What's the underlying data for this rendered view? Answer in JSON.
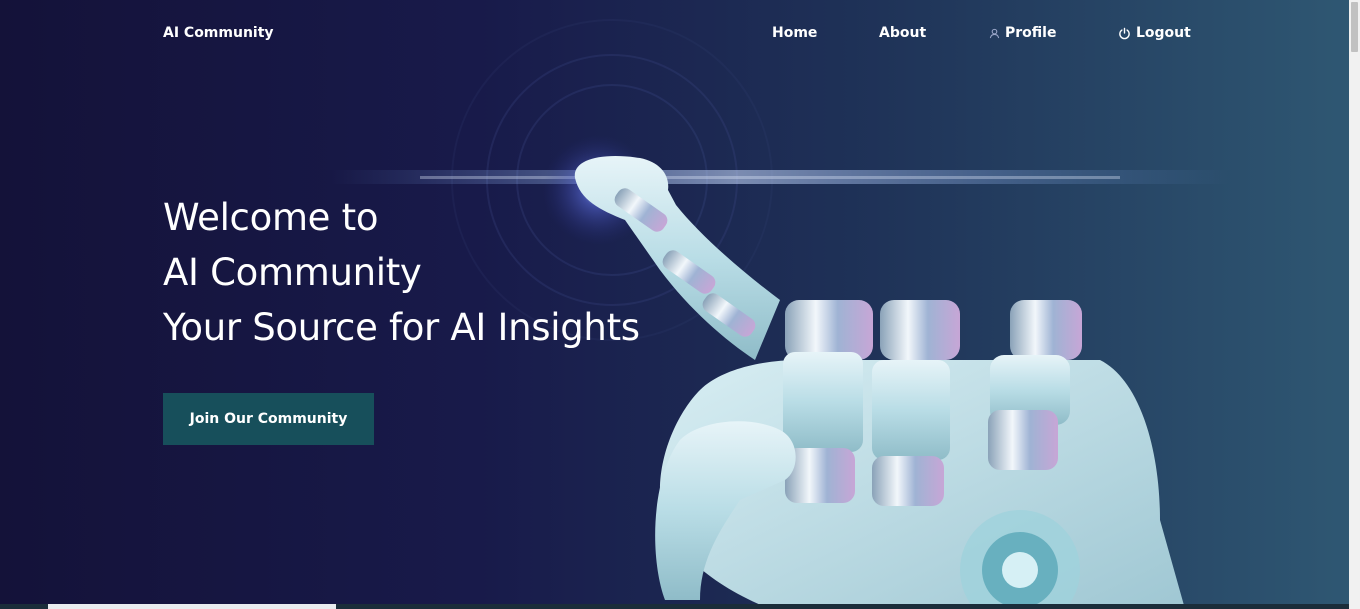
{
  "navbar": {
    "brand": "AI Community",
    "links": [
      {
        "label": "Home",
        "icon": ""
      },
      {
        "label": "About",
        "icon": ""
      },
      {
        "label": "Profile",
        "icon": "user-icon"
      },
      {
        "label": "Logout",
        "icon": "power-icon"
      }
    ]
  },
  "hero": {
    "title_lines": [
      "Welcome to",
      "AI Community",
      "Your Source for AI Insights"
    ],
    "cta_label": "Join Our Community",
    "image": "robot-hand-pointing"
  },
  "colors": {
    "background_dark": "#141239",
    "background_light": "#2f5873",
    "button": "#174f5b",
    "text": "#ffffff"
  }
}
